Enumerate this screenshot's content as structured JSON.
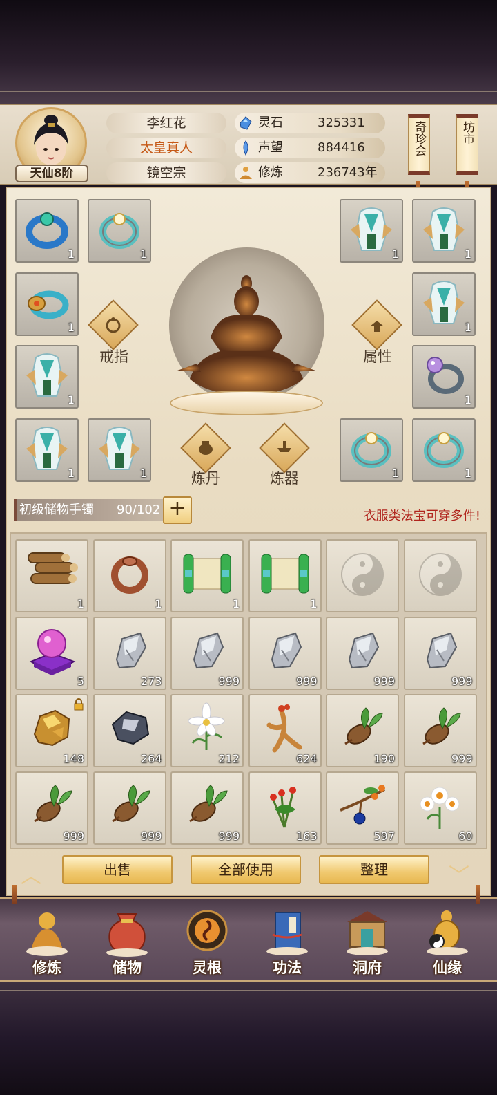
{
  "player": {
    "rank": "天仙8阶",
    "name": "李红花",
    "title": "太皇真人",
    "sect": "镜空宗"
  },
  "stats": [
    {
      "icon": "spirit-stone-icon",
      "label": "灵石",
      "value": "325331"
    },
    {
      "icon": "prestige-icon",
      "label": "声望",
      "value": "884416"
    },
    {
      "icon": "cultivation-icon",
      "label": "修炼",
      "value": "236743年"
    }
  ],
  "scrolls": {
    "treasure": "奇珍会",
    "market": "坊市"
  },
  "equipment": {
    "ring_label": "戒指",
    "attr_label": "属性",
    "alchemy_label": "炼丹",
    "forge_label": "炼器",
    "slots": [
      {
        "item": "blue-ring-icon",
        "count": "1"
      },
      {
        "item": "jade-ring-icon",
        "count": "1"
      },
      {
        "item": "robe-icon",
        "count": "1"
      },
      {
        "item": "robe-icon",
        "count": "1"
      },
      {
        "item": "gold-ring-icon",
        "count": "1"
      },
      {
        "item": "robe-icon",
        "count": "1"
      },
      {
        "item": "robe-icon",
        "count": "1"
      },
      {
        "item": "pearl-ring-icon",
        "count": "1"
      },
      {
        "item": "robe-icon",
        "count": "1"
      },
      {
        "item": "robe-icon",
        "count": "1"
      },
      {
        "item": "jade-ring-icon",
        "count": "1"
      },
      {
        "item": "jade-ring-icon",
        "count": "1"
      }
    ]
  },
  "bag": {
    "name": "初级储物手镯",
    "capacity": "90/102",
    "add": "+",
    "hint": "衣服类法宝可穿多件!"
  },
  "inventory": [
    {
      "item": "wood-icon",
      "count": "1"
    },
    {
      "item": "bronze-ring-icon",
      "count": "1"
    },
    {
      "item": "scroll-icon",
      "count": "1"
    },
    {
      "item": "scroll-icon",
      "count": "1"
    },
    {
      "item": "empty",
      "count": ""
    },
    {
      "item": "empty",
      "count": ""
    },
    {
      "item": "crystal-orb-icon",
      "count": "5"
    },
    {
      "item": "iron-ore-icon",
      "count": "273"
    },
    {
      "item": "iron-ore-icon",
      "count": "999"
    },
    {
      "item": "iron-ore-icon",
      "count": "999"
    },
    {
      "item": "iron-ore-icon",
      "count": "999"
    },
    {
      "item": "iron-ore-icon",
      "count": "999"
    },
    {
      "item": "gold-ore-icon",
      "count": "148",
      "locked": true
    },
    {
      "item": "dark-ore-icon",
      "count": "264"
    },
    {
      "item": "white-flower-icon",
      "count": "212"
    },
    {
      "item": "ginseng-icon",
      "count": "624"
    },
    {
      "item": "herb-root-icon",
      "count": "190"
    },
    {
      "item": "herb-root-icon",
      "count": "999"
    },
    {
      "item": "herb-root-icon",
      "count": "999"
    },
    {
      "item": "herb-root-icon",
      "count": "999"
    },
    {
      "item": "herb-root-icon",
      "count": "999"
    },
    {
      "item": "red-flower-herb-icon",
      "count": "163"
    },
    {
      "item": "berry-branch-icon",
      "count": "597"
    },
    {
      "item": "daisy-icon",
      "count": "60"
    }
  ],
  "actions": {
    "sell": "出售",
    "use_all": "全部使用",
    "sort": "整理"
  },
  "nav": [
    {
      "icon": "meditate-icon",
      "label": "修炼"
    },
    {
      "icon": "bag-icon",
      "label": "储物"
    },
    {
      "icon": "spirit-root-icon",
      "label": "灵根"
    },
    {
      "icon": "book-icon",
      "label": "功法"
    },
    {
      "icon": "cave-icon",
      "label": "洞府"
    },
    {
      "icon": "fortune-icon",
      "label": "仙缘"
    }
  ]
}
